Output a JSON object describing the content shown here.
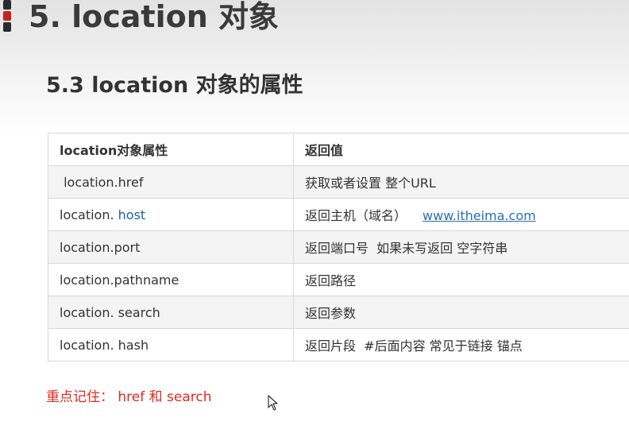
{
  "slide": {
    "title": "5. location 对象",
    "subtitle": "5.3 location 对象的属性"
  },
  "table": {
    "headers": [
      "location对象属性",
      "返回值"
    ],
    "rows": [
      {
        "prop": " location.href",
        "desc": "获取或者设置 整个URL",
        "link": ""
      },
      {
        "prop_prefix": "location. ",
        "prop_highlight": "host",
        "desc": "返回主机（域名）",
        "link": "www.itheima.com"
      },
      {
        "prop": "location.port",
        "desc": "返回端口号  如果未写返回 空字符串",
        "link": ""
      },
      {
        "prop": "location.pathname",
        "desc": "返回路径",
        "link": ""
      },
      {
        "prop": "location. search",
        "desc": "返回参数",
        "link": ""
      },
      {
        "prop": "location. hash",
        "desc": "返回片段  #后面内容 常见于链接 锚点",
        "link": ""
      }
    ]
  },
  "note": "重点记住： href 和 search",
  "colors": {
    "accent_red": "#c8201b",
    "note_red": "#e02a20",
    "link_blue": "#2a6fb3"
  }
}
